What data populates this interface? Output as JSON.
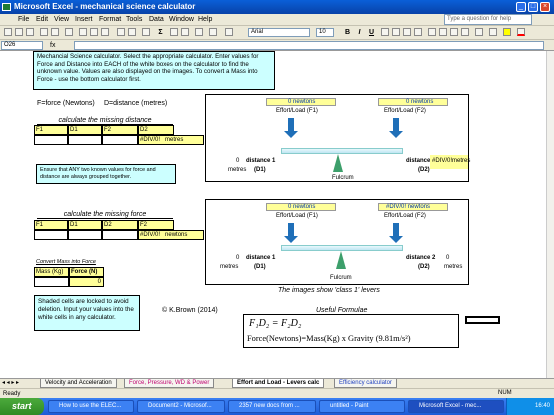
{
  "window": {
    "title": "Microsoft Excel - mechanical science calculator"
  },
  "menu": [
    "File",
    "Edit",
    "View",
    "Insert",
    "Format",
    "Tools",
    "Data",
    "Window",
    "Help"
  ],
  "ask_placeholder": "Type a question for help",
  "font": {
    "name": "Arial",
    "size": "10"
  },
  "name_box": "O26",
  "intro": "Mechancial Science calculator. Select the appropriate calculator. Enter values for Force and Distance into EACH of the white boxes on the calculator to find the unknown value. Values are also displayed on the images. To convert a Mass into Force - use the bottom calculator first.",
  "legend_force": "F=force (Newtons)",
  "legend_distance": "D=distance (metres)",
  "calc1": {
    "title": "calculate the missing distance",
    "headers": [
      "F1",
      "D1",
      "F2",
      "D2"
    ],
    "result": "#DIV/0!",
    "unit": "metres"
  },
  "note_ensure": "Ensure that ANY two known values for force and distance are always grouped together.",
  "calc2": {
    "title": "calculate the missing force",
    "headers": [
      "F1",
      "D1",
      "D2",
      "F2"
    ],
    "result": "#DIV/0!",
    "unit": "newtons"
  },
  "convert": {
    "title": "Convert Mass into Force",
    "mass_label": "Mass (Kg)",
    "force_label": "Force (N)",
    "force_value": "0"
  },
  "locked_note": "Shaded cells are locked to avoid deletion. Input your values into the white cells in any calculator.",
  "diagram1": {
    "f1_value": "0 newtons",
    "f2_value": "0 newtons",
    "f1_label": "Effort/Load (F1)",
    "f2_label": "Effort/Load (F2)",
    "d1_value": "0",
    "d1_unit": "metres",
    "d1_label": "distance 1",
    "d1_sub": "(D1)",
    "d2_label": "distance 2",
    "d2_value": "#DIV/0!",
    "d2_unit": "metres",
    "d2_sub": "(D2)",
    "fulcrum": "Fulcrum"
  },
  "diagram2": {
    "f1_value": "0 newtons",
    "f2_value": "#DIV/0! newtons",
    "f1_label": "Effort/Load (F1)",
    "f2_label": "Effort/Load (F2)",
    "d1_value": "0",
    "d1_unit": "metres",
    "d1_label": "distance 1",
    "d1_sub": "(D1)",
    "d2_label": "distance 2",
    "d2_value": "0",
    "d2_unit": "metres",
    "d2_sub": "(D2)",
    "fulcrum": "Fulcrum"
  },
  "caption": "The images show 'class 1' levers",
  "author": "© K.Brown (2014)",
  "formulae": {
    "title": "Useful Formulae",
    "f1": "F₁D₂ = F₂D₂",
    "f2": "Force(Newtons)=Mass(Kg) x Gravity (9.81m/s²)"
  },
  "tabs": [
    "Velocity and Acceleration",
    "Force, Pressure, WD & Power",
    "Effort and Load - Levers calc",
    "Efficiency calculator"
  ],
  "status": {
    "left": "Ready",
    "right": "NUM"
  },
  "taskbar": {
    "start": "start",
    "items": [
      "How to use the ELEC...",
      "Document2 - Microsof...",
      "2357 new docs from ...",
      "untitled - Paint",
      "Microsoft Excel - mec..."
    ],
    "clock": "16:40"
  }
}
